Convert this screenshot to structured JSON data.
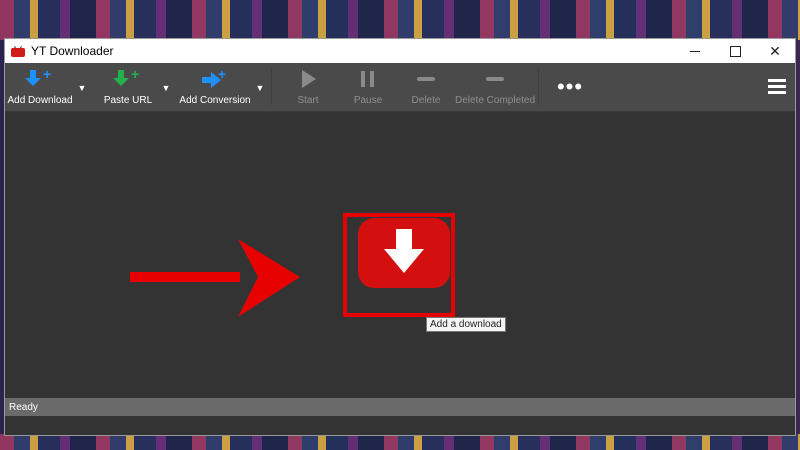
{
  "window": {
    "title": "YT Downloader",
    "controls": {
      "minimize": "minimize",
      "maximize": "maximize",
      "close": "✕"
    }
  },
  "toolbar": {
    "add_download": {
      "label": "Add Download",
      "icon": "download-arrow-plus-icon",
      "color": "#1e90ff"
    },
    "paste_url": {
      "label": "Paste URL",
      "icon": "download-arrow-plus-icon",
      "color": "#22b14c"
    },
    "add_conversion": {
      "label": "Add Conversion",
      "icon": "convert-arrow-plus-icon",
      "color": "#1e90ff"
    },
    "start": {
      "label": "Start",
      "icon": "play-icon"
    },
    "pause": {
      "label": "Pause",
      "icon": "pause-icon"
    },
    "delete": {
      "label": "Delete",
      "icon": "minus-icon"
    },
    "delete_completed": {
      "label": "Delete Completed",
      "icon": "minus-icon"
    },
    "more": {
      "label": "•••",
      "icon": "more-icon"
    },
    "menu": {
      "icon": "hamburger-menu-icon"
    }
  },
  "main": {
    "add_download_tooltip": "Add a download",
    "accent_color": "#d40f0f",
    "highlight_color": "#e60000"
  },
  "statusbar": {
    "text": "Ready"
  }
}
